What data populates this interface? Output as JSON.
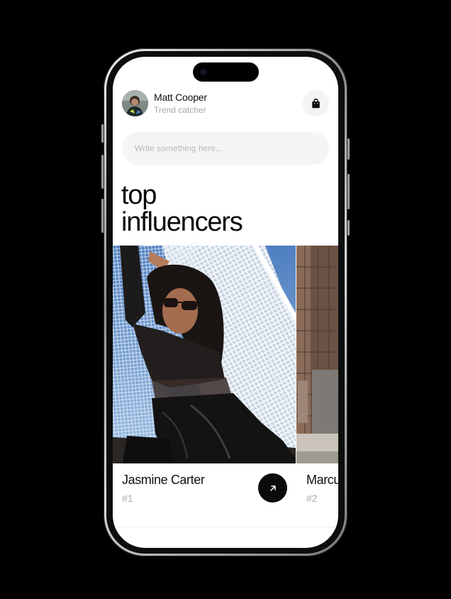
{
  "profile": {
    "name": "Matt Cooper",
    "role": "Trend catcher"
  },
  "search": {
    "placeholder": "Write something here..."
  },
  "title": {
    "line1": "top",
    "line2": "influencers"
  },
  "influencers": [
    {
      "name": "Jasmine Carter",
      "rank": "#1"
    },
    {
      "name": "Marcu",
      "rank": "#2"
    }
  ],
  "icons": {
    "header_action": "shopping-bag-icon",
    "card_action": "arrow-up-right-icon"
  },
  "colors": {
    "background": "#000000",
    "screen": "#ffffff",
    "accent": "#0b0b0b",
    "muted_text": "#a9a9a9",
    "search_bg": "#f5f5f5"
  }
}
